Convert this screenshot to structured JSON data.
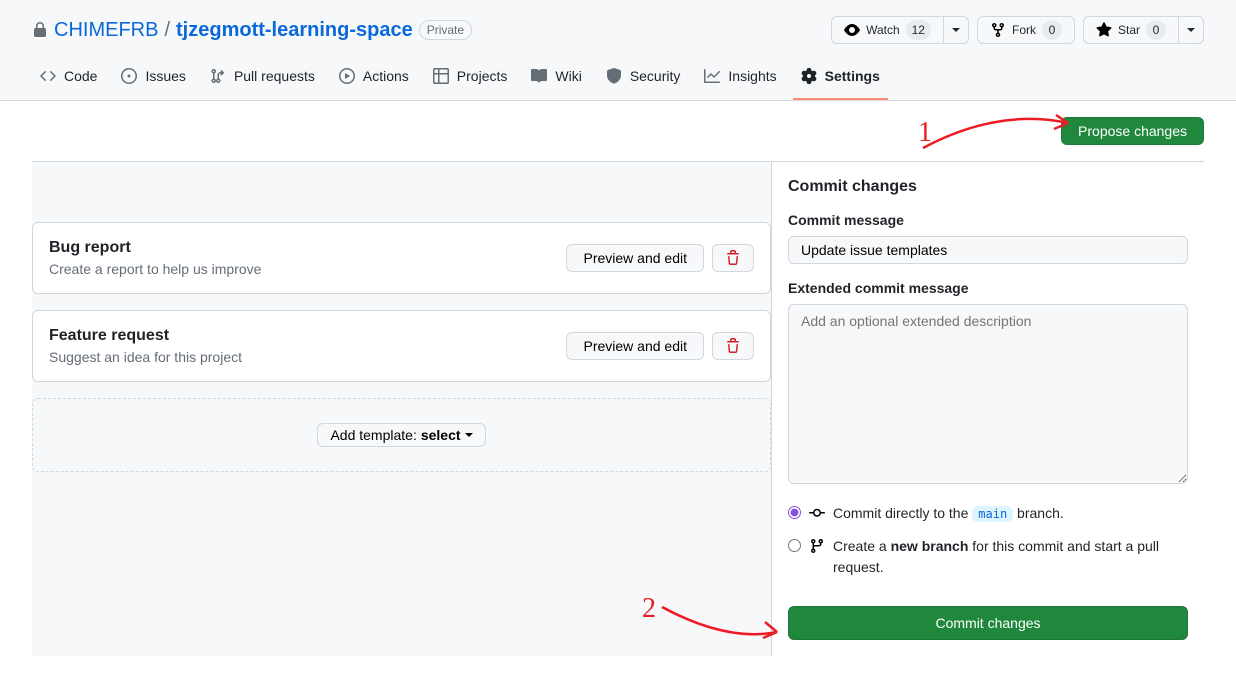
{
  "repo": {
    "owner": "CHIMEFRB",
    "name": "tjzegmott-learning-space",
    "visibility": "Private"
  },
  "actions": {
    "watch": {
      "label": "Watch",
      "count": "12"
    },
    "fork": {
      "label": "Fork",
      "count": "0"
    },
    "star": {
      "label": "Star",
      "count": "0"
    }
  },
  "tabs": {
    "code": "Code",
    "issues": "Issues",
    "pulls": "Pull requests",
    "actions": "Actions",
    "projects": "Projects",
    "wiki": "Wiki",
    "security": "Security",
    "insights": "Insights",
    "settings": "Settings"
  },
  "propose_btn": "Propose changes",
  "templates": [
    {
      "title": "Bug report",
      "desc": "Create a report to help us improve"
    },
    {
      "title": "Feature request",
      "desc": "Suggest an idea for this project"
    }
  ],
  "preview_btn": "Preview and edit",
  "add_template": {
    "prefix": "Add template: ",
    "label": "select"
  },
  "commit": {
    "heading": "Commit changes",
    "msg_label": "Commit message",
    "msg_value": "Update issue templates",
    "ext_label": "Extended commit message",
    "ext_placeholder": "Add an optional extended description",
    "opt1_prefix": "Commit directly to the ",
    "opt1_branch": "main",
    "opt1_suffix": " branch.",
    "opt2_prefix": "Create a ",
    "opt2_bold": "new branch",
    "opt2_suffix": " for this commit and start a pull request.",
    "button": "Commit changes"
  },
  "annotations": {
    "one": "1",
    "two": "2"
  }
}
